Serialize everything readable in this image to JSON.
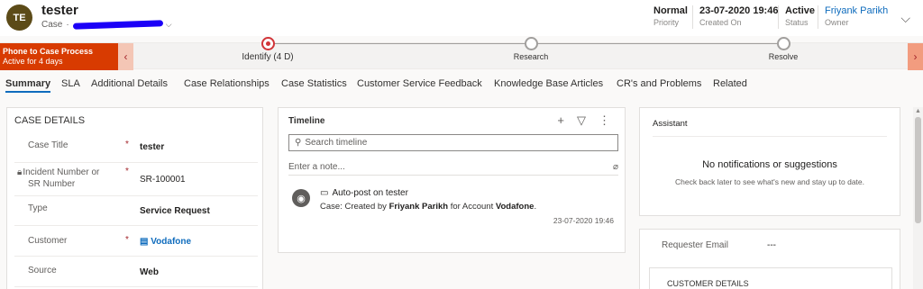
{
  "header": {
    "avatar_initials": "TE",
    "record_title": "tester",
    "entity_type": "Case",
    "separator": "·",
    "fields": [
      {
        "value": "Normal",
        "label": "Priority"
      },
      {
        "value": "23-07-2020 19:46",
        "label": "Created On"
      },
      {
        "value": "Active",
        "label": "Status"
      },
      {
        "value": "Friyank Parikh",
        "label": "Owner"
      }
    ]
  },
  "process": {
    "name": "Phone to Case Process",
    "duration": "Active for 4 days",
    "stages": [
      {
        "label": "Identify  (4 D)",
        "active": true
      },
      {
        "label": "Research",
        "active": false
      },
      {
        "label": "Resolve",
        "active": false
      }
    ]
  },
  "tabs": [
    "Summary",
    "SLA",
    "Additional Details",
    "Case Relationships",
    "Case Statistics",
    "Customer Service Feedback",
    "Knowledge Base Articles",
    "CR's and Problems",
    "Related"
  ],
  "case_details": {
    "title": "CASE DETAILS",
    "required_marker": "*",
    "rows": [
      {
        "label": "Case Title",
        "value": "tester"
      },
      {
        "label_line1": "Incident Number or",
        "label_line2": "SR Number",
        "value": "SR-100001"
      },
      {
        "label": "Type",
        "value": "Service Request"
      },
      {
        "label": "Customer",
        "value": "Vodafone"
      },
      {
        "label": "Source",
        "value": "Web"
      }
    ]
  },
  "timeline": {
    "title": "Timeline",
    "search_placeholder": "Search timeline",
    "note_placeholder": "Enter a note...",
    "post": {
      "title": "Auto-post on tester",
      "body_prefix": "Case: Created by ",
      "created_by": "Friyank Parikh",
      "body_mid": " for Account ",
      "account": "Vodafone",
      "body_suffix": ".",
      "date": "23-07-2020 19:46"
    }
  },
  "assistant": {
    "title": "Assistant",
    "message": "No notifications or suggestions",
    "sub_message": "Check back later to see what's new and stay up to date."
  },
  "requester": {
    "label": "Requester Email",
    "value": "---"
  },
  "customer_details": {
    "title": "CUSTOMER DETAILS"
  },
  "icons": [
    "chevron-down-icon",
    "chevron-left-icon",
    "chevron-right-icon",
    "plus-icon",
    "filter-icon",
    "more-icon",
    "search-icon",
    "paperclip-icon",
    "bot-icon",
    "post-icon",
    "lock-icon",
    "account-icon"
  ],
  "colors": {
    "accent": "#0f6cbd",
    "process_flag": "#d83b01",
    "active_stage": "#d13438",
    "avatar": "#5c4b18"
  }
}
